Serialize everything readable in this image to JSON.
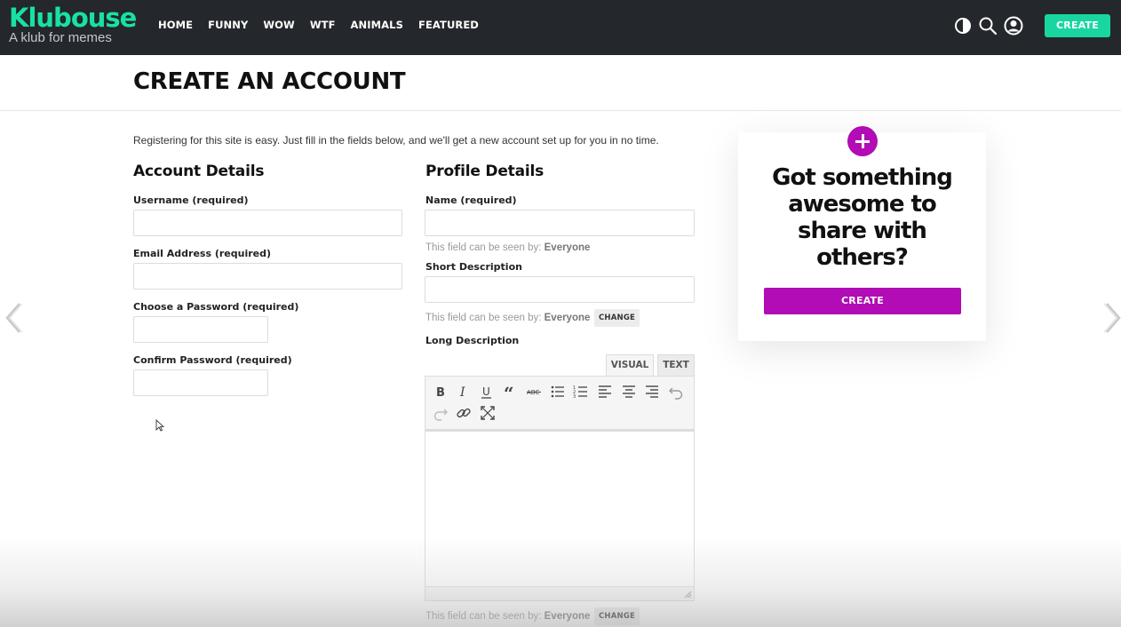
{
  "brand": {
    "name": "Klubouse",
    "tagline": "A klub for memes"
  },
  "nav": {
    "items": [
      "HOME",
      "FUNNY",
      "WOW",
      "WTF",
      "ANIMALS",
      "FEATURED"
    ]
  },
  "header": {
    "create_label": "CREATE",
    "icons": [
      "dark-mode-icon",
      "search-icon",
      "user-icon"
    ]
  },
  "page": {
    "title": "CREATE AN ACCOUNT",
    "intro": "Registering for this site is easy. Just fill in the fields below, and we'll get a new account set up for you in no time."
  },
  "account": {
    "title": "Account Details",
    "username_label": "Username (required)",
    "email_label": "Email Address (required)",
    "password_label": "Choose a Password (required)",
    "confirm_label": "Confirm Password (required)"
  },
  "profile": {
    "title": "Profile Details",
    "name_label": "Name (required)",
    "visibility_prefix": "This field can be seen by:",
    "visibility_value": "Everyone",
    "change_label": "CHANGE",
    "short_label": "Short Description",
    "long_label": "Long Description",
    "tab_visual": "VISUAL",
    "tab_text": "TEXT"
  },
  "editor": {
    "tools_row1": [
      "bold-icon",
      "italic-icon",
      "underline-icon",
      "blockquote-icon",
      "strikethrough-icon",
      "bullet-list-icon",
      "numbered-list-icon",
      "align-left-icon",
      "align-center-icon",
      "align-right-icon",
      "undo-icon"
    ],
    "tools_row2": [
      "redo-icon",
      "link-icon",
      "fullscreen-icon"
    ]
  },
  "sidecard": {
    "headline": "Got something awesome to share with others?",
    "button_label": "CREATE"
  },
  "colors": {
    "brand_green": "#19e0a6",
    "accent_purple": "#b10cb5",
    "header_bg": "#24272b"
  }
}
